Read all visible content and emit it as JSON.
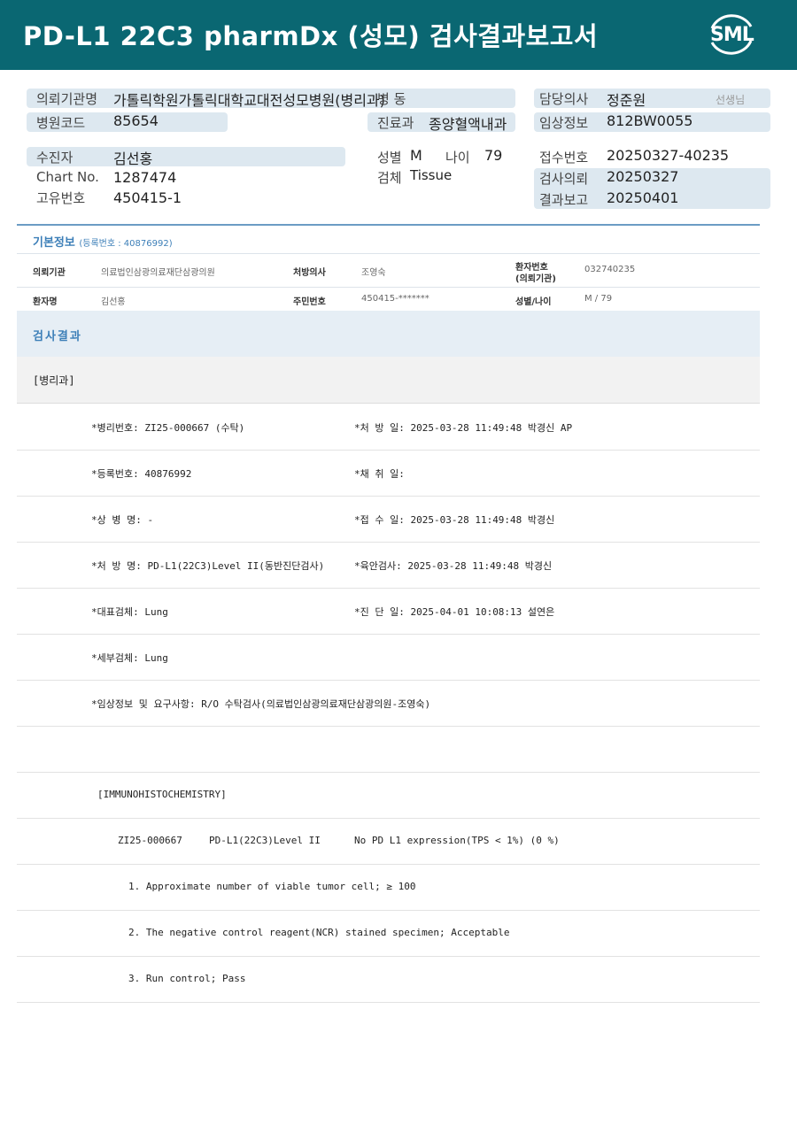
{
  "header": {
    "title": "PD-L1  22C3  pharmDx  (성모)  검사결과보고서",
    "logo_text": "SML"
  },
  "info": {
    "institution_label": "의뢰기관명",
    "institution_value": "가톨릭학원가톨릭대학교대전성모병원(병리과)",
    "ward_label": "병  동",
    "doctor_label": "담당의사",
    "doctor_value": "정준원",
    "doctor_suffix": "선생님",
    "hospital_code_label": "병원코드",
    "hospital_code_value": "85654",
    "dept_label": "진료과",
    "dept_value": "종양혈액내과",
    "clinical_label": "임상정보",
    "clinical_value": "812BW0055",
    "patient_label": "수진자",
    "patient_value": "김선홍",
    "sex_label": "성별",
    "sex_value": "M",
    "age_label": "나이",
    "age_value": "79",
    "receipt_label": "접수번호",
    "receipt_value": "20250327-40235",
    "chart_label": "Chart No.",
    "chart_value": "1287474",
    "specimen_label": "검체",
    "specimen_value": "Tissue",
    "request_label": "검사의뢰",
    "request_value": "20250327",
    "id_label": "고유번호",
    "id_value": "450415-1",
    "report_label": "결과보고",
    "report_value": "20250401"
  },
  "basic": {
    "title": "기본정보",
    "reg_no": "(등록번호 : 40876992)",
    "inst_label": "의뢰기관",
    "inst_value": "의료법인삼광의료재단삼광의원",
    "prescriber_label": "처방의사",
    "prescriber_value": "조영숙",
    "patno_label_1": "환자번호",
    "patno_label_2": "(의뢰기관)",
    "patno_value": "032740235",
    "name_label": "환자명",
    "name_value": "김선홍",
    "rrn_label": "주민번호",
    "rrn_value": "450415-*******",
    "sexage_label": "성별/나이",
    "sexage_value": "M / 79"
  },
  "result": {
    "title": "검사결과",
    "section": "[병리과]",
    "rows": [
      {
        "left": "*병리번호: ZI25-000667 (수탁)",
        "right": "*처 방 일: 2025-03-28 11:49:48  박경신 AP"
      },
      {
        "left": "*등록번호: 40876992",
        "right": "*채 취 일:"
      },
      {
        "left": "*상 병 명: -",
        "right": "*접 수 일: 2025-03-28 11:49:48  박경신"
      },
      {
        "left": "*처 방 명: PD-L1(22C3)Level II(동반진단검사)",
        "right": "*육안검사: 2025-03-28 11:49:48  박경신"
      },
      {
        "left": "*대표검체: Lung",
        "right": "*진 단 일: 2025-04-01 10:08:13  설연은"
      },
      {
        "left": "*세부검체: Lung",
        "right": ""
      },
      {
        "left": "*임상정보 및 요구사항: R/O 수탁검사(의료법인삼광의료재단삼광의원-조영숙)",
        "right": ""
      }
    ],
    "ihc_header": "[IMMUNOHISTOCHEMISTRY]",
    "ihc_id": "ZI25-000667",
    "ihc_test": "PD-L1(22C3)Level II",
    "ihc_result": "No PD L1 expression(TPS < 1%) (0 %)",
    "items": [
      "1. Approximate number of viable tumor cell; ≥ 100",
      "2. The negative control reagent(NCR) stained specimen; Acceptable",
      "3. Run control; Pass"
    ]
  },
  "colors": {
    "header_bg": "#0a6772",
    "pill_bg": "#dde8f0",
    "section_title": "#3d7fb8"
  }
}
